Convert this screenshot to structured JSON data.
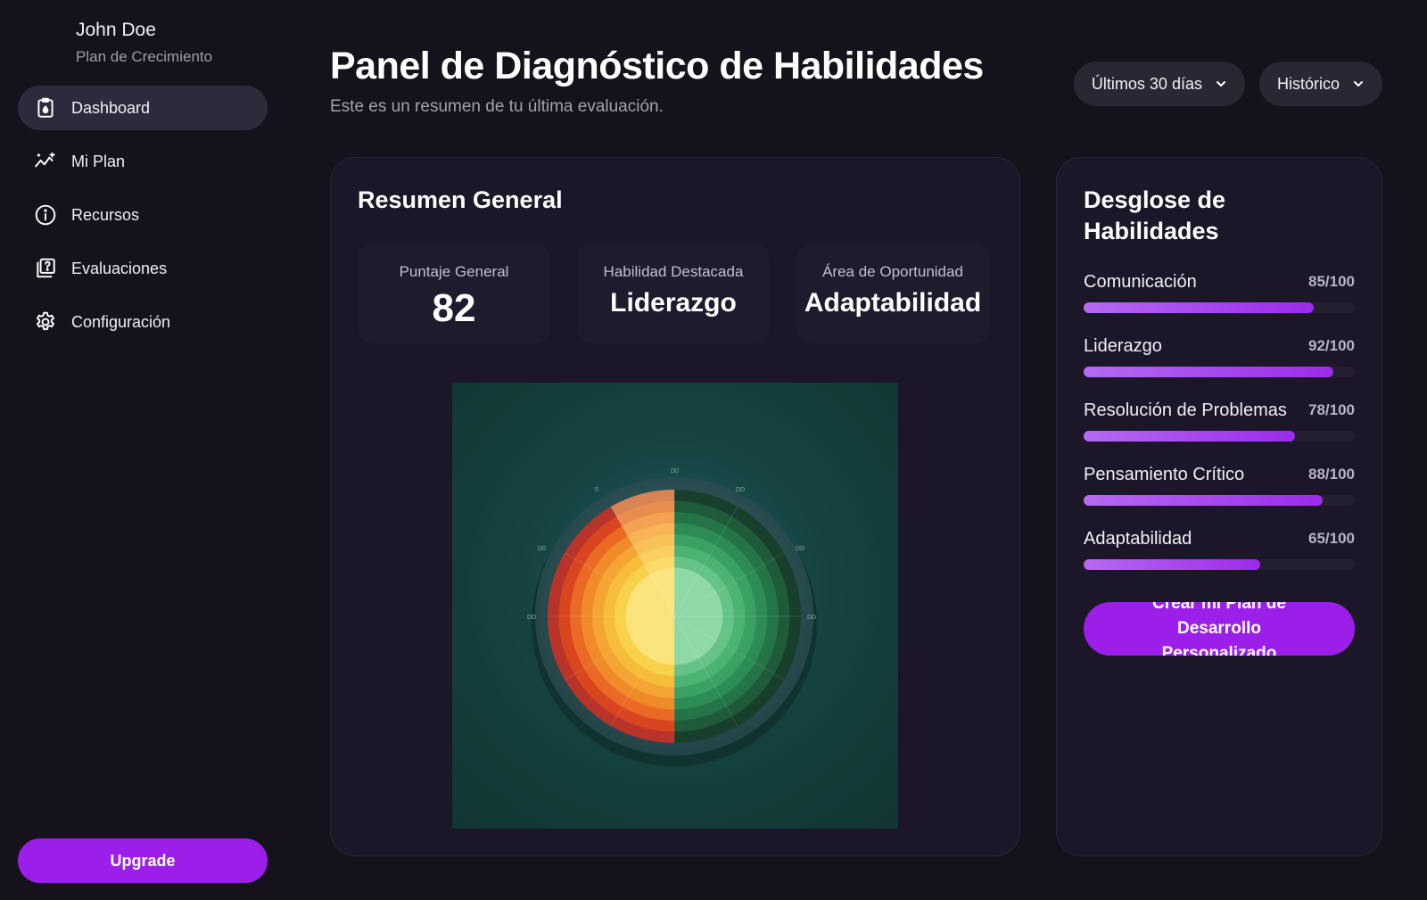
{
  "user": {
    "name": "John Doe",
    "plan": "Plan de Crecimiento"
  },
  "nav": [
    {
      "label": "Dashboard",
      "icon": "clipboard-icon",
      "active": true
    },
    {
      "label": "Mi Plan",
      "icon": "trend-icon",
      "active": false
    },
    {
      "label": "Recursos",
      "icon": "info-icon",
      "active": false
    },
    {
      "label": "Evaluaciones",
      "icon": "quiz-icon",
      "active": false
    },
    {
      "label": "Configuración",
      "icon": "gear-icon",
      "active": false
    }
  ],
  "upgrade_label": "Upgrade",
  "header": {
    "title": "Panel de Diagnóstico de Habilidades",
    "subtitle": "Este es un resumen de tu última evaluación."
  },
  "filters": {
    "period": "Últimos 30 días",
    "view": "Histórico"
  },
  "overview": {
    "title": "Resumen General",
    "stats": [
      {
        "label": "Puntaje General",
        "value": "82"
      },
      {
        "label": "Habilidad Destacada",
        "value": "Liderazgo"
      },
      {
        "label": "Área de Oportunidad",
        "value": "Adaptabilidad"
      }
    ],
    "wheel_colors": {
      "warm": [
        "#b8332a",
        "#d8451f",
        "#ea6a25",
        "#f08b2a",
        "#f4a534",
        "#f6bd3c",
        "#f7d24a",
        "#f9e37a"
      ],
      "cool": [
        "#173f2c",
        "#1f5a39",
        "#257447",
        "#2d8c55",
        "#3aa064",
        "#4cb374",
        "#65c289",
        "#8fd9a7"
      ]
    }
  },
  "breakdown": {
    "title": "Desglose de Habilidades",
    "skills": [
      {
        "name": "Comunicación",
        "score": "85/100",
        "value": 85
      },
      {
        "name": "Liderazgo",
        "score": "92/100",
        "value": 92
      },
      {
        "name": "Resolución de Problemas",
        "score": "78/100",
        "value": 78
      },
      {
        "name": "Pensamiento Crítico",
        "score": "88/100",
        "value": 88
      },
      {
        "name": "Adaptabilidad",
        "score": "65/100",
        "value": 65
      }
    ],
    "cta_label": "Crear mi Plan de Desarrollo Personalizado"
  },
  "colors": {
    "accent": "#9b1fe8",
    "background": "#15121b",
    "card": "#1b1628"
  }
}
